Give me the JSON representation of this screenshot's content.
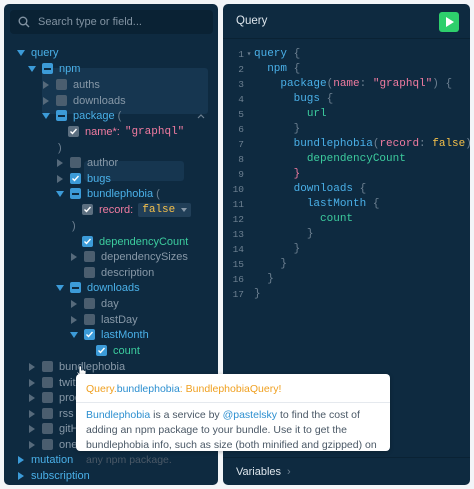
{
  "explorer": {
    "search_placeholder": "Search type or field...",
    "tree": {
      "query": "query",
      "npm": "npm",
      "authors": "auths",
      "downloads_top": "downloads",
      "package": "package",
      "package_paren": "(",
      "package_arg_name": "name*:",
      "package_arg_value": "\"graphql\"",
      "package_close": ")",
      "author": "author",
      "bugs": "bugs",
      "bundlephobia": "bundlephobia",
      "bundlephobia_paren": "(",
      "record_label": "record:",
      "record_value": "false",
      "bundlephobia_close": ")",
      "dependencyCount": "dependencyCount",
      "dependencySizes": "dependencySizes",
      "description": "description",
      "downloads": "downloads",
      "day": "day",
      "lastDay": "lastDay",
      "lastMonth": "lastMonth",
      "count": "count",
      "bundlephobia2": "bundlephobia",
      "twitter": "twit",
      "product": "prod",
      "rss": "rss",
      "github": "gitH",
      "onegraph": "oneG",
      "mutation": "mutation",
      "subscription": "subscription"
    }
  },
  "tooltip": {
    "type_prefix": "Query.",
    "field": "bundlephobia",
    "colon": ":",
    "type_name": "BundlephobiaQuery",
    "bang": "!",
    "desc_link": "Bundlephobia",
    "desc_1": " is a service by ",
    "desc_author": "@pastelsky",
    "desc_2": " to find the cost of adding an npm package to your bundle. Use it to get the bundlephobia info, such as size (both minified and gzipped) on any npm package."
  },
  "editor": {
    "title": "Query",
    "run_label": "Run",
    "variables_label": "Variables",
    "variables_chevron": "›",
    "lines": [
      "1",
      "2",
      "3",
      "4",
      "5",
      "6",
      "7",
      "8",
      "9",
      "10",
      "11",
      "12",
      "13",
      "14",
      "15",
      "16",
      "17"
    ],
    "code": {
      "l1_kw": "query",
      "l1_p": " {",
      "l2_f": "npm",
      "l2_p": " {",
      "l3_f": "package",
      "l3_p1": "(",
      "l3_a": "name",
      "l3_p2": ": ",
      "l3_s": "\"graphql\"",
      "l3_p3": ") {",
      "l4_f": "bugs",
      "l4_p": " {",
      "l5_f": "url",
      "l6_p": "}",
      "l7_f": "bundlephobia",
      "l7_p1": "(",
      "l7_a": "record",
      "l7_p2": ": ",
      "l7_v": "false",
      "l7_p3": ") {",
      "l8_f": "dependencyCount",
      "l9_p": "}",
      "l10_f": "downloads",
      "l10_p": " {",
      "l11_f": "lastMonth",
      "l11_p": " {",
      "l12_f": "count",
      "l13_p": "}",
      "l14_p": "}",
      "l15_p": "}",
      "l16_p": "}",
      "l17_p": "}"
    }
  }
}
